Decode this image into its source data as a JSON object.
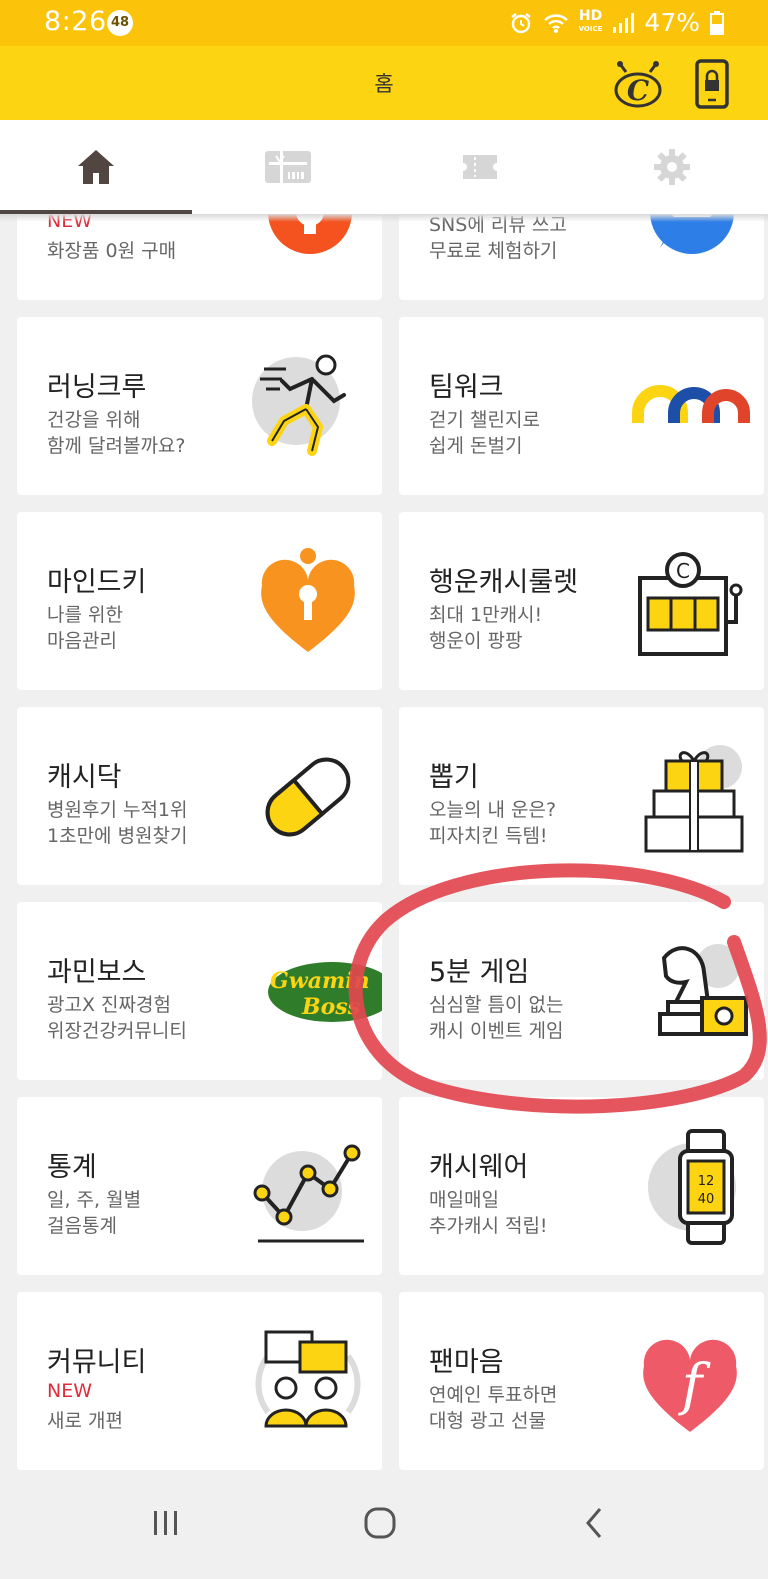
{
  "status": {
    "time": "8:26",
    "badge": "48",
    "hd": "HD",
    "hd_sub": "VOICE",
    "battery": "47%"
  },
  "header": {
    "title": "홈"
  },
  "icons": {
    "tab_home": "home-icon",
    "tab_gift": "gift-card-icon",
    "tab_ticket": "ticket-icon",
    "tab_settings": "gear-icon",
    "header_left": "cashdeer-character-icon",
    "header_right": "lock-phone-icon"
  },
  "colors": {
    "accent": "#fcd412",
    "status": "#fbc40a",
    "new": "#e12d39",
    "circle": "#e3464f"
  },
  "cards": [
    {
      "title": "",
      "line1": "NEW",
      "line2": "화장품 0원 구매",
      "new1": true,
      "icon": "gear-orange-icon"
    },
    {
      "title": "",
      "line1": "SNS에 리뷰 쓰고",
      "line2": "무료로 체험하기",
      "icon": "chat-bubble-icon"
    },
    {
      "title": "러닝크루",
      "line1": "건강을 위해",
      "line2": "함께 달려볼까요?",
      "icon": "runner-icon"
    },
    {
      "title": "팀워크",
      "line1": "걷기 챌린지로",
      "line2": "쉽게 돈벌기",
      "icon": "team-arches-icon"
    },
    {
      "title": "마인드키",
      "line1": "나를 위한",
      "line2": "마음관리",
      "icon": "heart-keyhole-icon"
    },
    {
      "title": "행운캐시룰렛",
      "line1": "최대 1만캐시!",
      "line2": "행운이 팡팡",
      "icon": "slot-machine-icon"
    },
    {
      "title": "캐시닥",
      "line1": "병원후기 누적1위",
      "line2": "1초만에 병원찾기",
      "icon": "pill-icon"
    },
    {
      "title": "뽑기",
      "line1": "오늘의 내 운은?",
      "line2": "피자치킨 득템!",
      "icon": "gift-boxes-icon"
    },
    {
      "title": "과민보스",
      "line1": "광고X 진짜경험",
      "line2": "위장건강커뮤니티",
      "icon": "gwamin-boss-logo",
      "logo_text1": "Gwamin",
      "logo_text2": "Boss"
    },
    {
      "title": "5분 게임",
      "line1": "심심할 틈이 없는",
      "line2": "캐시 이벤트 게임",
      "icon": "chess-knight-icon"
    },
    {
      "title": "통계",
      "line1": "일, 주, 월별",
      "line2": "걸음통계",
      "icon": "line-chart-icon"
    },
    {
      "title": "캐시웨어",
      "line1": "매일매일",
      "line2": "추가캐시 적립!",
      "icon": "smartwatch-icon",
      "watch1": "12",
      "watch2": "40"
    },
    {
      "title": "커뮤니티",
      "line1": "NEW",
      "line2": "새로 개편",
      "new1": true,
      "icon": "community-icon"
    },
    {
      "title": "팬마음",
      "line1": "연예인 투표하면",
      "line2": "대형 광고 선물",
      "icon": "fan-heart-icon",
      "glyph": "f"
    }
  ],
  "nav": {
    "recent": "recent-apps-icon",
    "home": "home-button-icon",
    "back": "back-icon"
  }
}
